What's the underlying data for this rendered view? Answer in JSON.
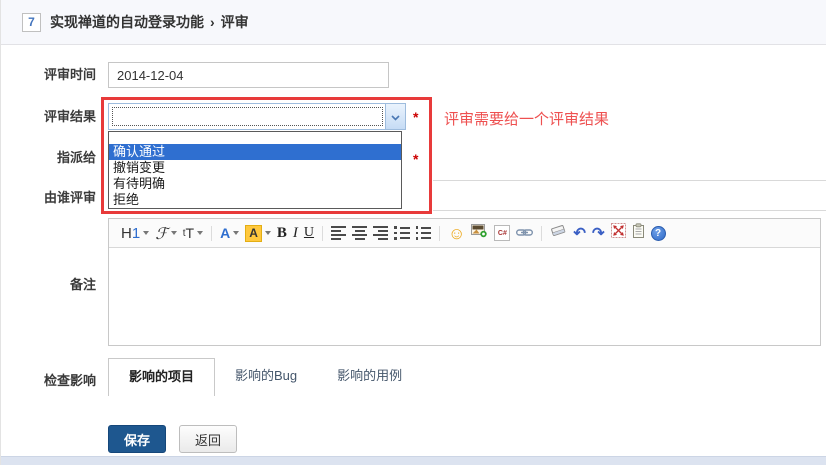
{
  "header": {
    "badge": "7",
    "title": "实现禅道的自动登录功能",
    "separator": "›",
    "page": "评审"
  },
  "form": {
    "review_time": {
      "label": "评审时间",
      "value": "2014-12-04"
    },
    "review_result": {
      "label": "评审结果",
      "required_marker": "*",
      "selected_value": "",
      "options": [
        "",
        "确认通过",
        "撤销变更",
        "有待明确",
        "拒绝"
      ],
      "highlighted_option": "确认通过"
    },
    "assigned_to": {
      "label": "指派给",
      "required_marker": "*"
    },
    "reviewed_by": {
      "label": "由谁评审"
    },
    "comment": {
      "label": "备注"
    },
    "check_impact": {
      "label": "检查影响",
      "tabs": [
        {
          "label": "影响的项目",
          "active": true
        },
        {
          "label": "影响的Bug",
          "active": false
        },
        {
          "label": "影响的用例",
          "active": false
        }
      ]
    },
    "actions": {
      "save": "保存",
      "back": "返回"
    }
  },
  "annotation": {
    "text": "评审需要给一个评审结果",
    "box_color": "#e83a3a",
    "text_color": "#ee5050"
  },
  "editor": {
    "toolbar": {
      "heading_h": "H",
      "heading_1": "1",
      "font_family": "ℱ",
      "size_small": "t",
      "size_big": "T",
      "fore_color": "A",
      "back_color": "A",
      "bold": "B",
      "italic": "I",
      "underline": "U",
      "code": "C#",
      "smiley": "☺",
      "undo": "↶",
      "redo": "↷",
      "help": "?"
    }
  },
  "colors": {
    "highlight_blue": "#2f6fd0",
    "save_button": "#1e578f",
    "badge_blue": "#4374bd",
    "required_red": "#cc0000",
    "annotation_red": "#e83a3a"
  }
}
